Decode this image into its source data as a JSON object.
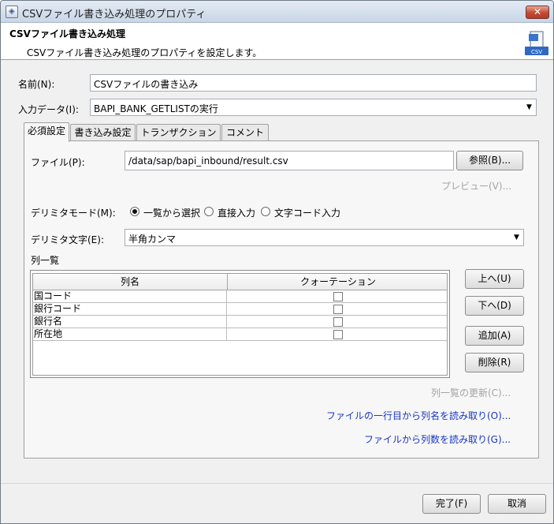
{
  "window": {
    "title": "CSVファイル書き込み処理のプロパティ",
    "close_symbol": "✕"
  },
  "header": {
    "title": "CSVファイル書き込み処理",
    "description": "CSVファイル書き込み処理のプロパティを設定します。",
    "icon": "csv-file-icon",
    "icon_text": "CSV"
  },
  "form": {
    "name_label": "名前(N):",
    "name_value": "CSVファイルの書き込み",
    "input_label": "入力データ(I):",
    "input_value": "BAPI_BANK_GETLISTの実行"
  },
  "tabs": [
    "必須設定",
    "書き込み設定",
    "トランザクション",
    "コメント"
  ],
  "required": {
    "file_label": "ファイル(P):",
    "file_value": "/data/sap/bapi_inbound/result.csv",
    "browse_button": "参照(B)...",
    "preview_button": "プレビュー(V)...",
    "delimiter_mode_label": "デリミタモード(M):",
    "delimiter_modes": [
      "一覧から選択",
      "直接入力",
      "文字コード入力"
    ],
    "delimiter_mode_selected": "一覧から選択",
    "delimiter_char_label": "デリミタ文字(E):",
    "delimiter_char_value": "半角カンマ",
    "column_list_label": "列一覧",
    "table": {
      "headers": [
        "列名",
        "クォーテーション"
      ],
      "rows": [
        {
          "name": "国コード",
          "quote": false
        },
        {
          "name": "銀行コード",
          "quote": false
        },
        {
          "name": "銀行名",
          "quote": false
        },
        {
          "name": "所在地",
          "quote": false
        }
      ]
    },
    "up_button": "上へ(U)",
    "down_button": "下へ(D)",
    "add_button": "追加(A)",
    "delete_button": "削除(R)",
    "refresh_link": "列一覧の更新(C)...",
    "read_names_link": "ファイルの一行目から列名を読み取り(O)...",
    "read_count_link": "ファイルから列数を読み取り(G)..."
  },
  "footer": {
    "ok_button": "完了(F)",
    "cancel_button": "取消"
  }
}
